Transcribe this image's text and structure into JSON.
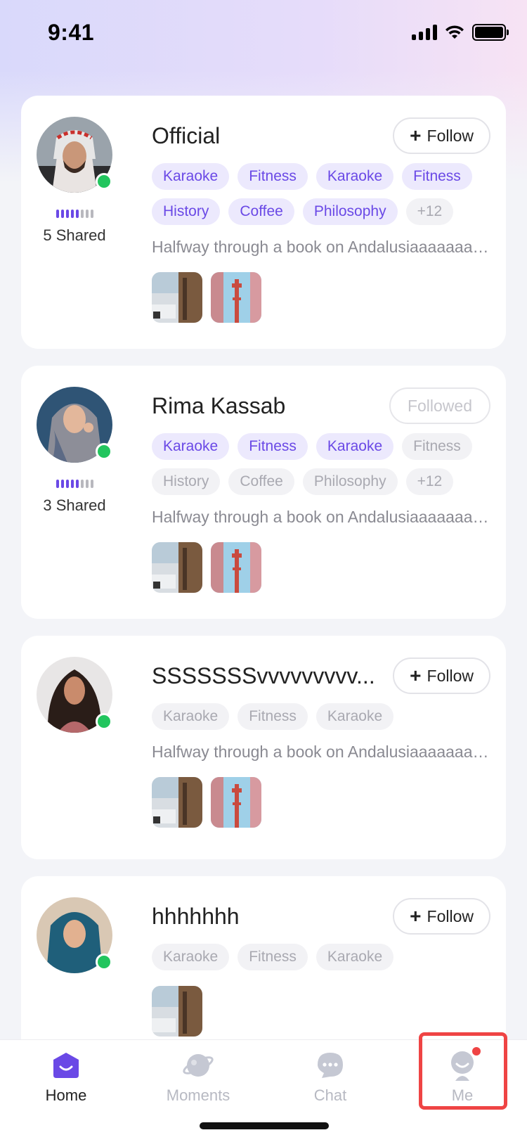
{
  "status_bar": {
    "time": "9:41"
  },
  "feed": [
    {
      "name": "Official",
      "follow_label": "Follow",
      "followed": false,
      "shared_label": "5 Shared",
      "shared_level": 5,
      "tags": [
        {
          "label": "Karaoke",
          "active": true
        },
        {
          "label": "Fitness",
          "active": true
        },
        {
          "label": "Karaoke",
          "active": true
        },
        {
          "label": "Fitness",
          "active": true
        },
        {
          "label": "History",
          "active": true
        },
        {
          "label": "Coffee",
          "active": true
        },
        {
          "label": "Philosophy",
          "active": true
        },
        {
          "label": "+12",
          "active": false
        }
      ],
      "bio": "Halfway through a book on Andalusiaaaaaaaaaaaa...",
      "avatar": "man-headscarf-portrait"
    },
    {
      "name": "Rima Kassab",
      "follow_label": "Followed",
      "followed": true,
      "shared_label": "3 Shared",
      "shared_level": 5,
      "tags": [
        {
          "label": "Karaoke",
          "active": true
        },
        {
          "label": "Fitness",
          "active": true
        },
        {
          "label": "Karaoke",
          "active": true
        },
        {
          "label": "Fitness",
          "active": false
        },
        {
          "label": "History",
          "active": false
        },
        {
          "label": "Coffee",
          "active": false
        },
        {
          "label": "Philosophy",
          "active": false
        },
        {
          "label": "+12",
          "active": false
        }
      ],
      "bio": "Halfway through a book on Andalusiaaaaaaaaaaaa...",
      "avatar": "woman-shawl-portrait"
    },
    {
      "name": "SSSSSSSvvvvvvvvv...",
      "follow_label": "Follow",
      "followed": false,
      "tags": [
        {
          "label": "Karaoke",
          "active": false
        },
        {
          "label": "Fitness",
          "active": false
        },
        {
          "label": "Karaoke",
          "active": false
        }
      ],
      "bio": "Halfway through a book on Andalusiaaaaaaaaaaaa...",
      "avatar": "woman-curly-hair-portrait"
    },
    {
      "name": "hhhhhhh",
      "follow_label": "Follow",
      "followed": false,
      "tags": [
        {
          "label": "Karaoke",
          "active": false
        },
        {
          "label": "Fitness",
          "active": false
        },
        {
          "label": "Karaoke",
          "active": false
        }
      ],
      "avatar": "woman-hijab-portrait"
    }
  ],
  "tabbar": {
    "home": "Home",
    "moments": "Moments",
    "chat": "Chat",
    "me": "Me"
  },
  "colors": {
    "accent": "#6a49e6",
    "tag_bg": "#ece9fd",
    "online": "#22c55e",
    "badge": "#ef4444"
  }
}
